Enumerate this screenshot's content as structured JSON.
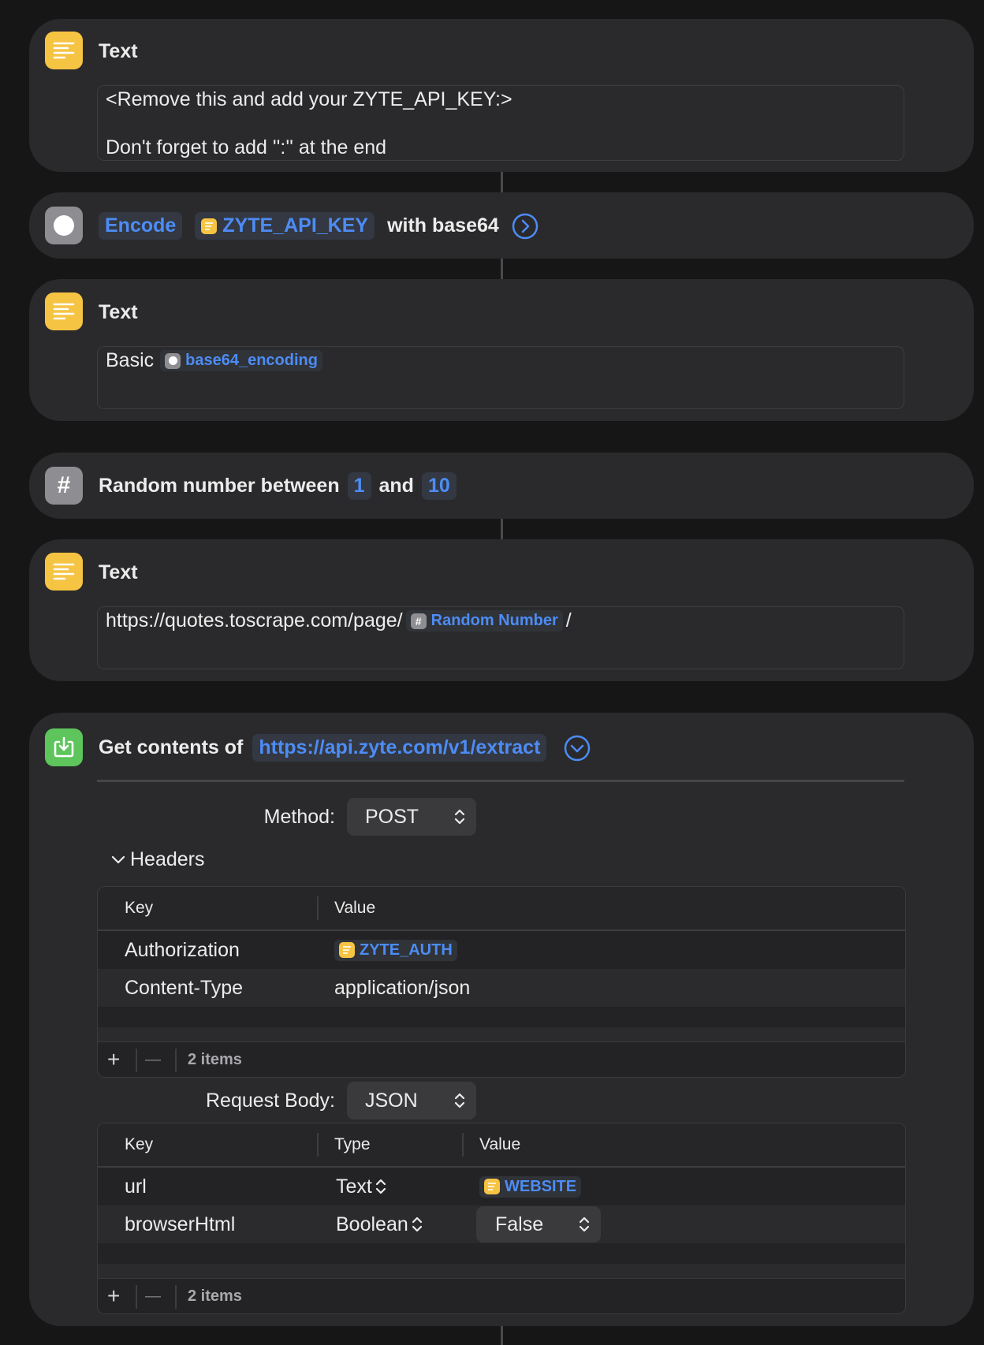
{
  "text_action_1": {
    "title": "Text",
    "line1": "<Remove this and add your ZYTE_API_KEY:>",
    "line2": "Don't forget to add '':'' at the end"
  },
  "encode_action": {
    "verb": "Encode",
    "variable": "ZYTE_API_KEY",
    "suffix": "with base64"
  },
  "text_action_2": {
    "title": "Text",
    "prefix": "Basic",
    "variable": "base64_encoding"
  },
  "random_action": {
    "label": "Random number between",
    "min": "1",
    "and_label": "and",
    "max": "10"
  },
  "text_action_3": {
    "title": "Text",
    "prefix": "https://quotes.toscrape.com/page/",
    "variable": "Random Number",
    "suffix": "/"
  },
  "get_contents": {
    "label": "Get contents of",
    "url": "https://api.zyte.com/v1/extract",
    "method_label": "Method:",
    "method_value": "POST",
    "headers_label": "Headers",
    "headers_columns": [
      "Key",
      "Value"
    ],
    "headers_rows": [
      {
        "key": "Authorization",
        "value": "ZYTE_AUTH"
      },
      {
        "key": "Content-Type",
        "value": "application/json"
      }
    ],
    "headers_count": "2 items",
    "body_label": "Request Body:",
    "body_value": "JSON",
    "body_columns": [
      "Key",
      "Type",
      "Value"
    ],
    "body_rows": [
      {
        "key": "url",
        "type": "Text",
        "value": "WEBSITE"
      },
      {
        "key": "browserHtml",
        "type": "Boolean",
        "value": "False"
      }
    ],
    "body_count": "2 items",
    "add_symbol": "+",
    "remove_symbol": "—"
  },
  "colors": {
    "background": "#161617",
    "card": "#2a2a2c",
    "accent_blue": "#4d8cf5",
    "icon_yellow": "#f6c443",
    "icon_gray": "#8e8e92",
    "icon_green": "#5dc55b"
  }
}
